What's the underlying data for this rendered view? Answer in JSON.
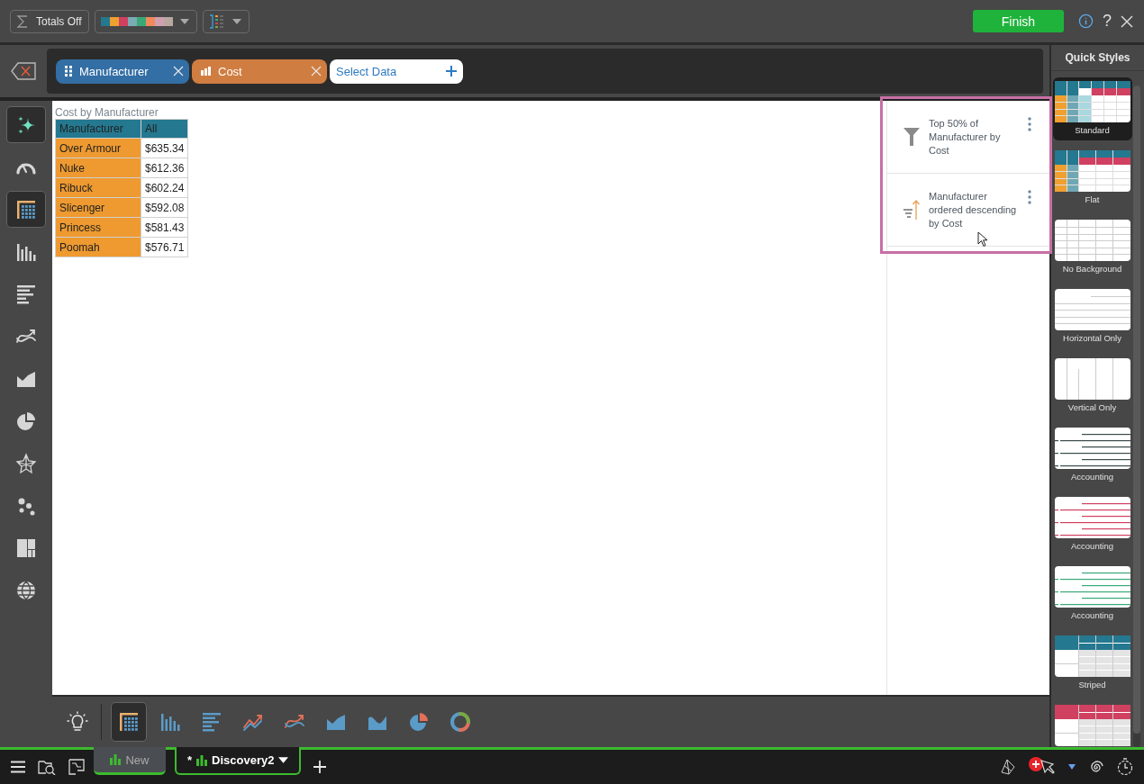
{
  "toolbar": {
    "totals_label": "Totals Off",
    "palette": [
      {
        "color": "#24788f"
      },
      {
        "color": "#f0a030"
      },
      {
        "color": "#d04060"
      },
      {
        "color": "#7aacb4"
      },
      {
        "color": "#3aa878"
      },
      {
        "color": "#f08a5a"
      },
      {
        "color": "#d0a0b0"
      },
      {
        "color": "#b8a8a0"
      }
    ],
    "finish_label": "Finish",
    "help_label": "?"
  },
  "fields": [
    {
      "label": "Manufacturer",
      "kind": "dimension"
    },
    {
      "label": "Cost",
      "kind": "measure"
    }
  ],
  "select_data": {
    "label": "Select Data"
  },
  "sidebar": [
    {
      "kind": "sparkle",
      "selected": true
    },
    {
      "kind": "gauge",
      "selected": false
    },
    {
      "kind": "table",
      "selected": true
    },
    {
      "kind": "bar",
      "selected": false
    },
    {
      "kind": "hbar",
      "selected": false
    },
    {
      "kind": "curve",
      "selected": false
    },
    {
      "kind": "area",
      "selected": false
    },
    {
      "kind": "pie",
      "selected": false
    },
    {
      "kind": "radar",
      "selected": false
    },
    {
      "kind": "scatter",
      "selected": false
    },
    {
      "kind": "treemap",
      "selected": false
    },
    {
      "kind": "globe",
      "selected": false
    }
  ],
  "table": {
    "title": "Cost by Manufacturer",
    "columns": [
      "Manufacturer",
      "All"
    ],
    "rows": [
      [
        "Over Armour",
        "$635.34"
      ],
      [
        "Nuke",
        "$612.36"
      ],
      [
        "Ribuck",
        "$602.24"
      ],
      [
        "Slicenger",
        "$592.08"
      ],
      [
        "Princess",
        "$581.43"
      ],
      [
        "Poomah",
        "$576.71"
      ]
    ]
  },
  "filters": [
    {
      "kind": "filter",
      "text": "Top 50% of Manufacturer by Cost"
    },
    {
      "kind": "sort",
      "text": "Manufacturer ordered descending by Cost"
    }
  ],
  "quick_styles": {
    "title": "Quick Styles",
    "styles": [
      {
        "label": "Standard",
        "kind": "standard",
        "selected": true
      },
      {
        "label": "Flat",
        "kind": "flat",
        "selected": false
      },
      {
        "label": "No Background",
        "kind": "grid",
        "selected": false
      },
      {
        "label": "Horizontal Only",
        "kind": "horizontal",
        "selected": false
      },
      {
        "label": "Vertical Only",
        "kind": "vertical",
        "selected": false
      },
      {
        "label": "Accounting",
        "kind": "accounting",
        "color": "#3a4a4a",
        "selected": false
      },
      {
        "label": "Accounting",
        "kind": "accounting",
        "color": "#d04060",
        "selected": false
      },
      {
        "label": "Accounting",
        "kind": "accounting",
        "color": "#3aa878",
        "selected": false
      },
      {
        "label": "Striped",
        "kind": "striped",
        "color": "#24788f",
        "selected": false
      },
      {
        "kind": "striped",
        "color": "#d04060",
        "selected": false
      }
    ]
  },
  "chart_bar": [
    {
      "kind": "idea",
      "selected": false
    },
    {
      "kind": "table",
      "selected": true
    },
    {
      "kind": "bar",
      "selected": false
    },
    {
      "kind": "hbar",
      "selected": false
    },
    {
      "kind": "line",
      "selected": false
    },
    {
      "kind": "curve",
      "selected": false
    },
    {
      "kind": "area",
      "selected": false
    },
    {
      "kind": "wave",
      "selected": false
    },
    {
      "kind": "pie",
      "selected": false
    },
    {
      "kind": "donut",
      "selected": false
    }
  ],
  "taskbar": {
    "tabs": [
      {
        "label": "New",
        "selected": false
      },
      {
        "label": "Discovery2",
        "selected": true,
        "mark": "*"
      }
    ]
  }
}
